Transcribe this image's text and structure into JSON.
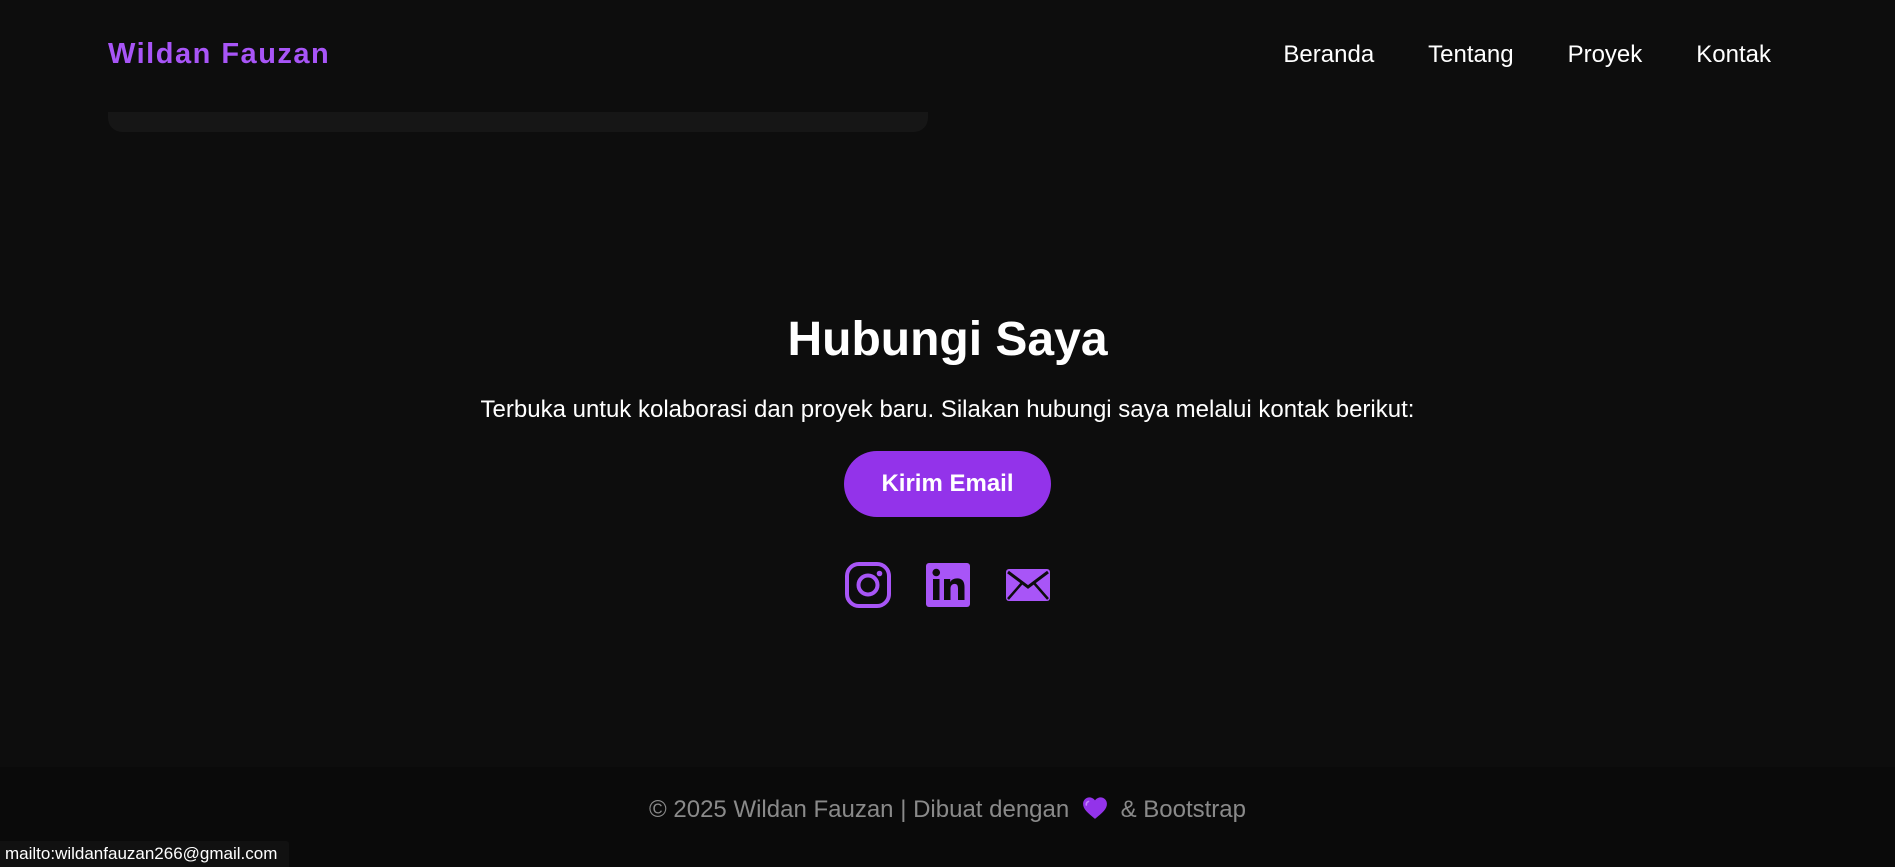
{
  "brand": "Wildan Fauzan",
  "nav": {
    "items": [
      {
        "label": "Beranda"
      },
      {
        "label": "Tentang"
      },
      {
        "label": "Proyek"
      },
      {
        "label": "Kontak"
      }
    ]
  },
  "contact": {
    "title": "Hubungi Saya",
    "text": "Terbuka untuk kolaborasi dan proyek baru. Silakan hubungi saya melalui kontak berikut:",
    "button_label": "Kirim Email",
    "socials": [
      {
        "icon": "instagram-icon"
      },
      {
        "icon": "linkedin-icon"
      },
      {
        "icon": "envelope-icon"
      }
    ]
  },
  "footer": {
    "text_before": "© 2025 Wildan Fauzan | Dibuat dengan",
    "heart_icon": "purple-heart-icon",
    "text_after": "& Bootstrap"
  },
  "status_bar": {
    "url": "mailto:wildanfauzan266@gmail.com"
  },
  "colors": {
    "background": "#0d0d0d",
    "accent": "#a855f7",
    "button": "#9333ea",
    "footer_text": "#8a8a8a"
  }
}
